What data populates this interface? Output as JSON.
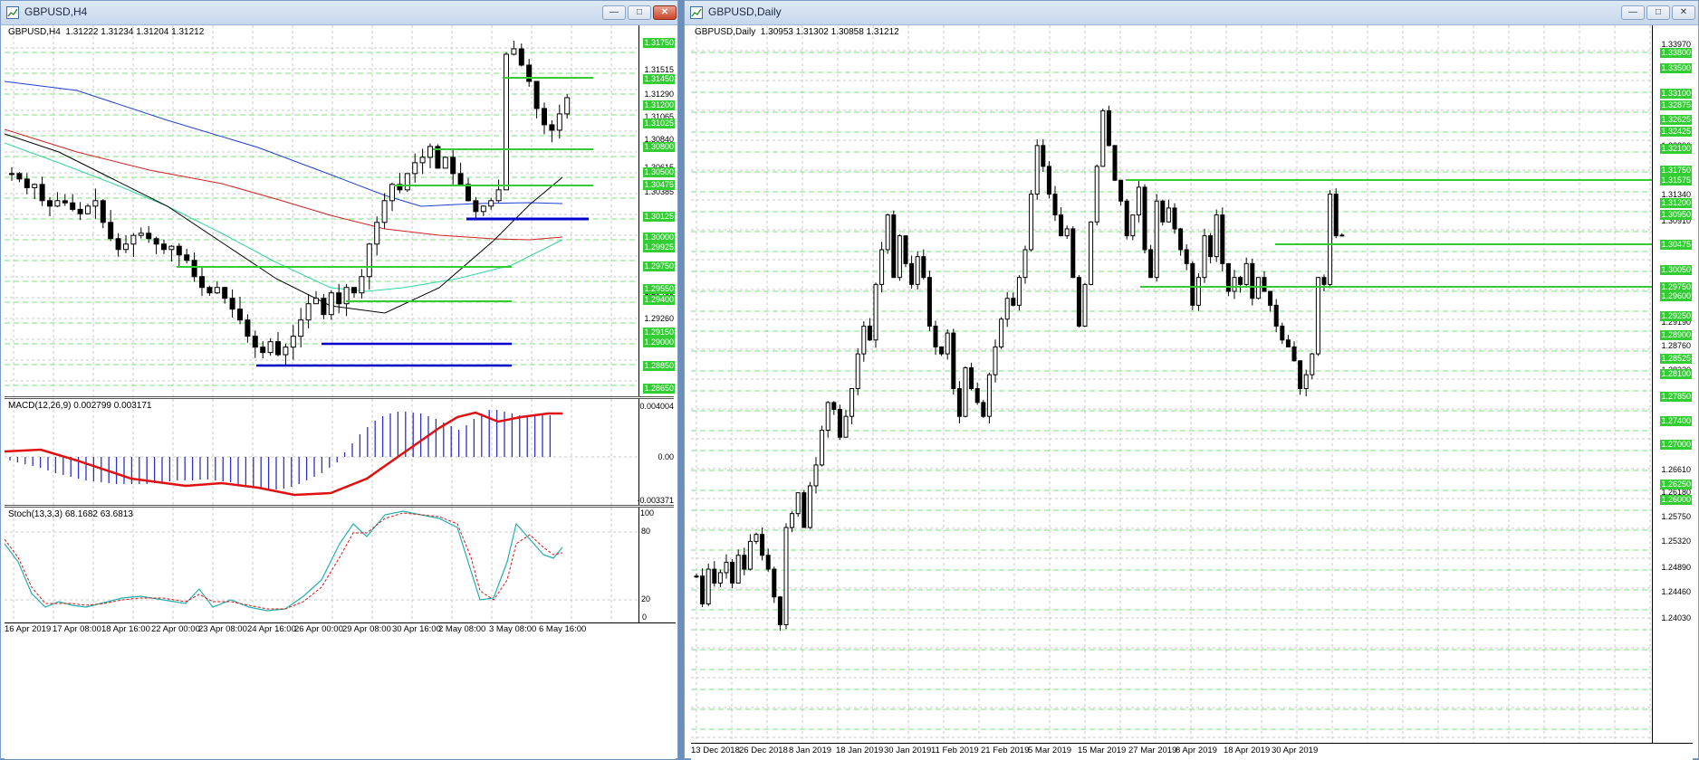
{
  "h4": {
    "window_title": "GBPUSD,H4",
    "header": "GBPUSD,H4  1.31222 1.31234 1.31204 1.31212",
    "price_labels": [
      "1.31515",
      "1.31290",
      "1.31065",
      "1.30840",
      "1.30615",
      "1.30385",
      "1.30160",
      "1.29935",
      "1.29710",
      "1.29485",
      "1.29260",
      "1.29035",
      "1.28810",
      "1.28585"
    ],
    "level_labels": [
      "1.31750",
      "1.31450",
      "1.31200",
      "1.31025",
      "1.30800",
      "1.30500",
      "1.30475",
      "1.30125",
      "1.30000",
      "1.29925",
      "1.29750",
      "1.29550",
      "1.29400",
      "1.29150",
      "1.29000",
      "1.28850",
      "1.28650"
    ],
    "time_labels": [
      "16 Apr 2019",
      "17 Apr 08:00",
      "18 Apr 16:00",
      "22 Apr 00:00",
      "23 Apr 08:00",
      "24 Apr 16:00",
      "26 Apr 00:00",
      "29 Apr 08:00",
      "30 Apr 16:00",
      "2 May 08:00",
      "3 May 08:00",
      "6 May 16:00"
    ],
    "macd": {
      "header": "MACD(12,26,9) 0.002799 0.003171",
      "max": "0.004004",
      "zero": "0.00",
      "min": "-0.003371"
    },
    "stoch": {
      "header": "Stoch(13,3,3) 68.1682 63.6813",
      "levels": [
        "100",
        "80",
        "20",
        "0"
      ]
    }
  },
  "daily": {
    "window_title": "GBPUSD,Daily",
    "header": "GBPUSD,Daily  1.30953 1.31302 1.30858 1.31212",
    "price_labels": [
      "1.33970",
      "1.33540",
      "1.33110",
      "1.32680",
      "1.32200",
      "1.31770",
      "1.31340",
      "1.30910",
      "1.30480",
      "1.30050",
      "1.29620",
      "1.29190",
      "1.28760",
      "1.28330",
      "1.27900",
      "1.27470",
      "1.27040",
      "1.26610",
      "1.26180",
      "1.25750",
      "1.25320",
      "1.24890",
      "1.24460",
      "1.24030"
    ],
    "level_labels": [
      "1.33800",
      "1.33500",
      "1.33100",
      "1.32875",
      "1.32625",
      "1.32425",
      "1.32100",
      "1.31750",
      "1.31575",
      "1.31200",
      "1.30950",
      "1.30475",
      "1.30050",
      "1.29750",
      "1.29600",
      "1.29250",
      "1.28900",
      "1.28525",
      "1.28100",
      "1.27850",
      "1.27400",
      "1.27000",
      "1.26250",
      "1.26000"
    ],
    "time_labels": [
      "13 Dec 2018",
      "26 Dec 2018",
      "8 Jan 2019",
      "18 Jan 2019",
      "30 Jan 2019",
      "11 Feb 2019",
      "21 Feb 2019",
      "5 Mar 2019",
      "15 Mar 2019",
      "27 Mar 2019",
      "8 Apr 2019",
      "18 Apr 2019",
      "30 Apr 2019"
    ]
  },
  "colors": {
    "level": "#32cd32",
    "support": "#0000cd",
    "ma_blue": "#1f3fd6",
    "ma_red": "#d62020",
    "ma_black": "#000000",
    "ma_green": "#33d6a0",
    "macd_hist": "#3030c8",
    "macd_signal": "#e01010",
    "stoch_main": "#20b0b0",
    "stoch_signal": "#e01010"
  }
}
